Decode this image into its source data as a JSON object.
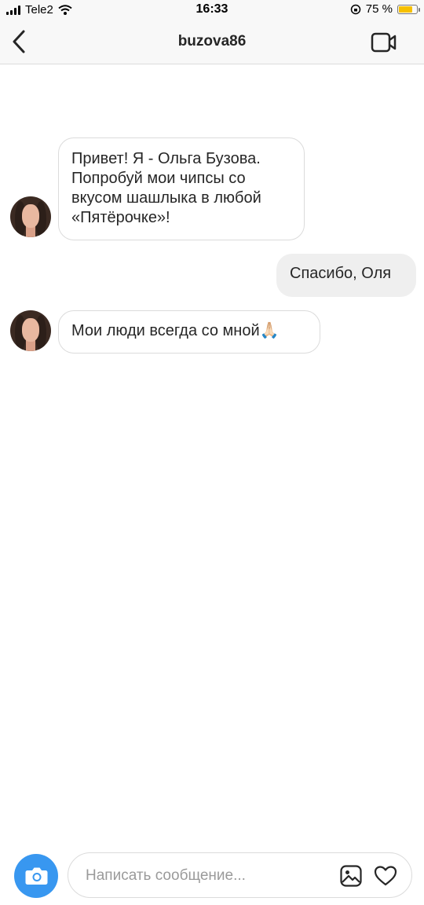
{
  "status_bar": {
    "carrier": "Tele2",
    "time": "16:33",
    "battery_percent": "75 %",
    "battery_level": 0.75,
    "battery_color": "#f6c000"
  },
  "header": {
    "title": "buzova86",
    "back_icon": "chevron-left-icon",
    "video_icon": "video-camera-icon"
  },
  "messages": [
    {
      "direction": "incoming",
      "lines": [
        "Привет! Я - Ольга Бузова.",
        "Попробуй мои чипсы со",
        "вкусом шашлыка в любой",
        "«Пятёрочке»!"
      ]
    },
    {
      "direction": "outgoing",
      "text": "Спасибо, Оля"
    },
    {
      "direction": "incoming",
      "text": "Мои люди всегда со мной🙏🏻"
    }
  ],
  "composer": {
    "placeholder": "Написать сообщение...",
    "camera_icon": "camera-icon",
    "gallery_icon": "image-gallery-icon",
    "heart_icon": "heart-icon",
    "accent_color": "#3897f0"
  }
}
